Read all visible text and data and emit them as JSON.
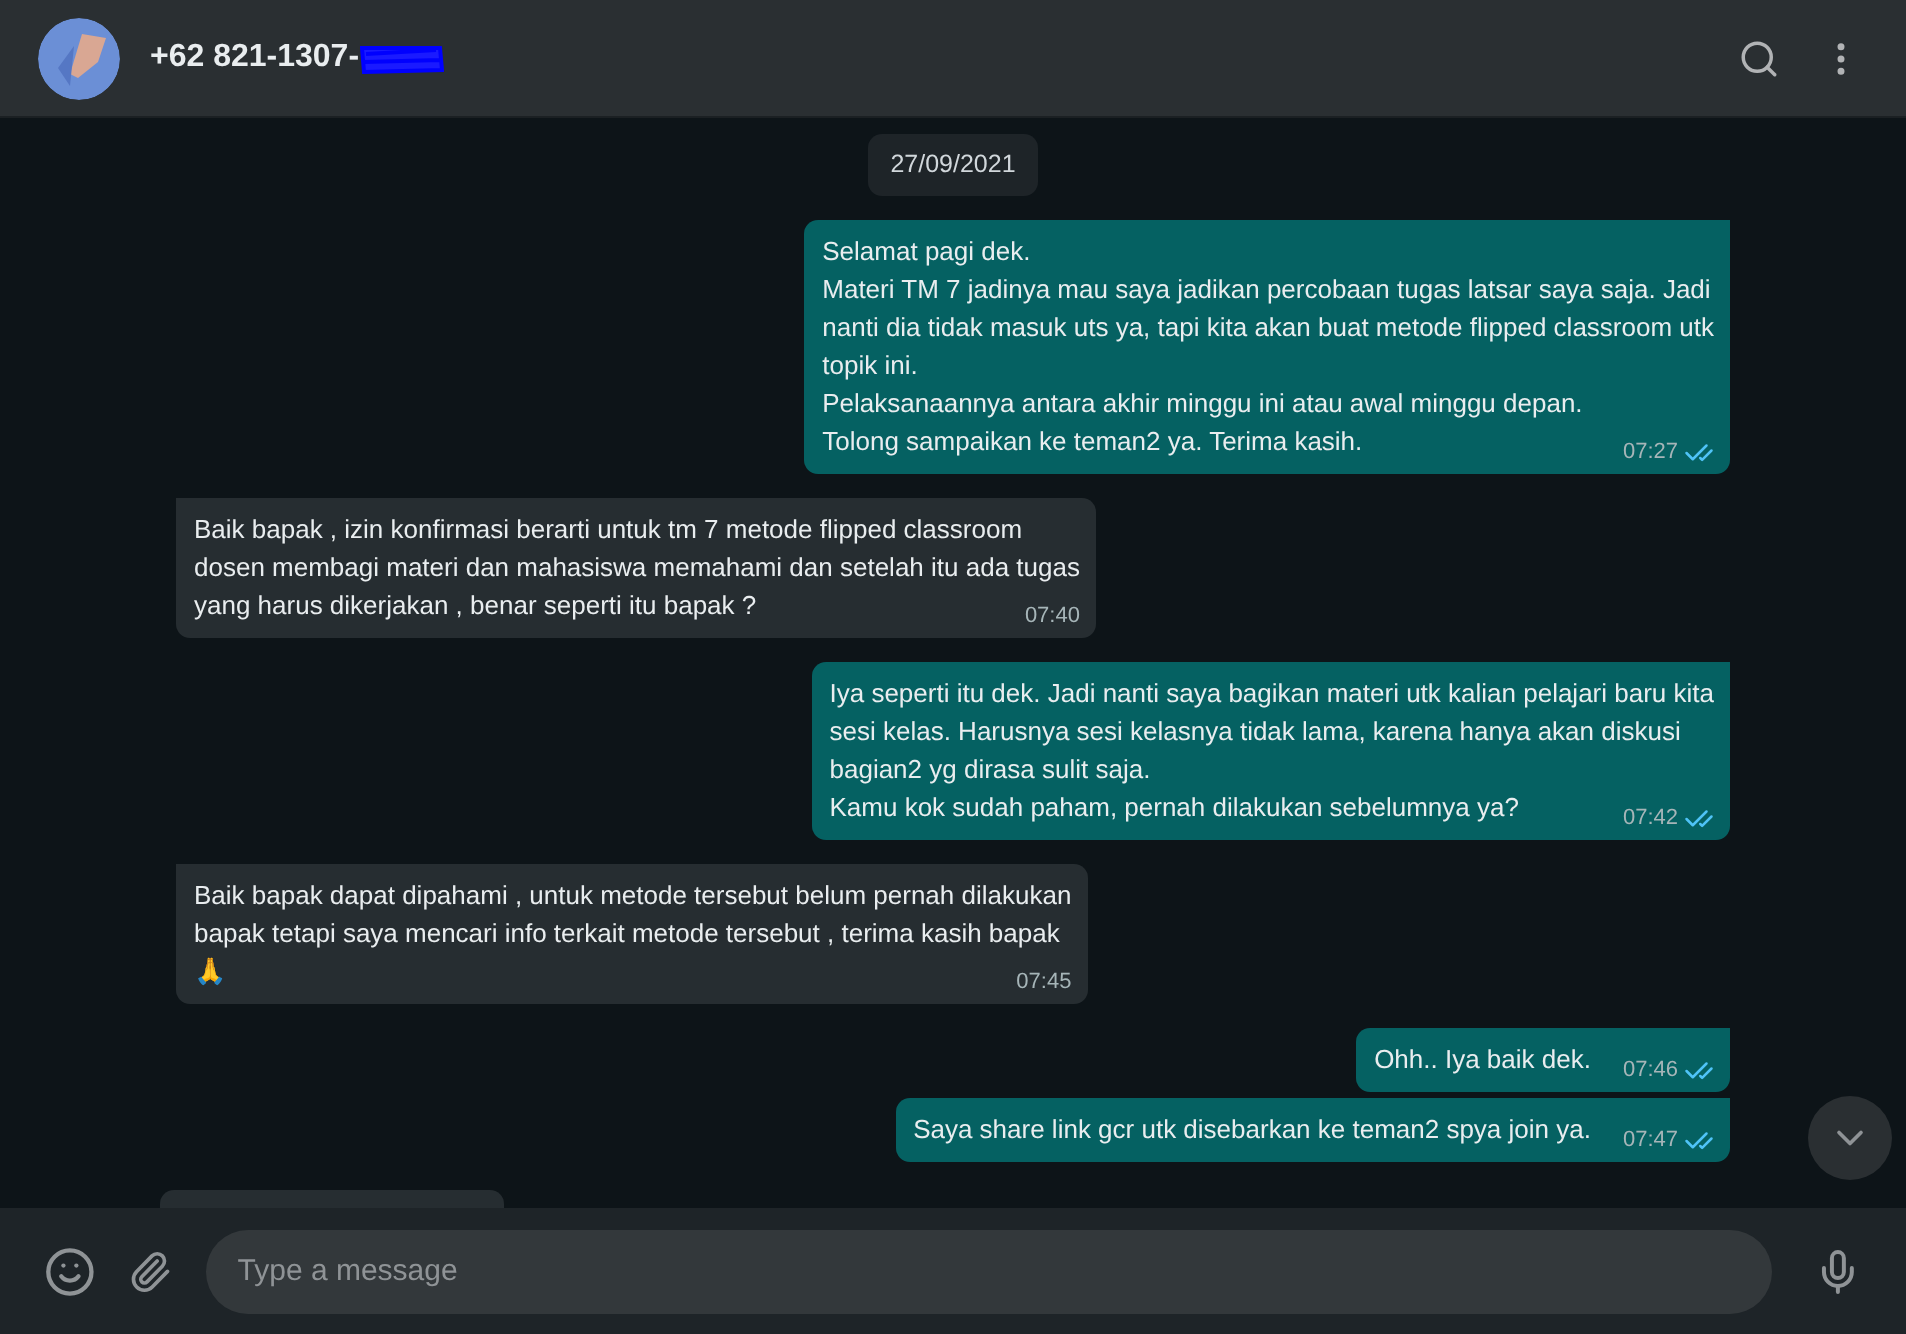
{
  "header": {
    "contact": "+62 821-1307-",
    "redacted": true
  },
  "date_chip": "27/09/2021",
  "messages": [
    {
      "kind": "out",
      "lines": [
        "Selamat pagi dek.",
        "Materi TM 7 jadinya mau saya jadikan percobaan tugas latsar saya saja. Jadi",
        "nanti dia tidak masuk uts ya, tapi kita akan buat metode flipped classroom utk",
        "topik ini.",
        "Pelaksanaannya antara akhir minggu ini atau awal minggu depan.",
        "Tolong sampaikan ke teman2 ya. Terima kasih."
      ],
      "time": "07:27",
      "read": true
    },
    {
      "kind": "in",
      "lines": [
        "Baik bapak , izin konfirmasi berarti untuk tm 7 metode flipped classroom",
        "dosen membagi materi dan mahasiswa memahami dan setelah itu ada tugas",
        "yang harus dikerjakan , benar seperti itu bapak ?"
      ],
      "time": "07:40"
    },
    {
      "kind": "out",
      "lines": [
        "Iya seperti itu dek. Jadi nanti saya bagikan materi utk kalian pelajari baru kita",
        "sesi kelas. Harusnya sesi kelasnya tidak lama, karena hanya akan diskusi",
        "bagian2 yg dirasa sulit saja.",
        "Kamu kok sudah paham, pernah dilakukan sebelumnya ya?"
      ],
      "time": "07:42",
      "read": true
    },
    {
      "kind": "in",
      "lines": [
        "Baik bapak dapat dipahami , untuk metode tersebut belum pernah dilakukan",
        "bapak tetapi saya mencari info terkait metode tersebut , terima kasih bapak",
        "🙏"
      ],
      "time": "07:45"
    },
    {
      "kind": "out",
      "lines": [
        "Ohh.. Iya baik dek."
      ],
      "time": "07:46",
      "read": true
    },
    {
      "kind": "out",
      "lines": [
        "Saya share link gcr utk disebarkan ke teman2 spya join ya."
      ],
      "time": "07:47",
      "read": true
    }
  ],
  "composer": {
    "placeholder": "Type a message"
  }
}
